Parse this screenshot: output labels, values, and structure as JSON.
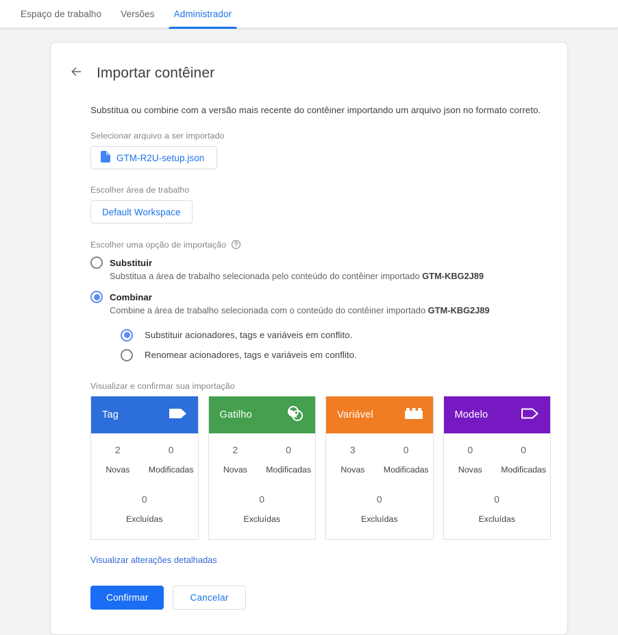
{
  "topbar": {
    "tabs": [
      {
        "label": "Espaço de trabalho",
        "active": false
      },
      {
        "label": "Versões",
        "active": false
      },
      {
        "label": "Administrador",
        "active": true
      }
    ]
  },
  "card": {
    "back_icon": "arrow-left-icon",
    "title": "Importar contêiner",
    "intro": "Substitua ou combine com a versão mais recente do contêiner importando um arquivo json no formato correto.",
    "file_section": {
      "label": "Selecionar arquivo a ser importado",
      "file_icon": "file-icon",
      "file_name": "GTM-R2U-setup.json"
    },
    "workspace_section": {
      "label": "Escolher área de trabalho",
      "workspace_name": "Default Workspace"
    },
    "import_option": {
      "label": "Escolher uma opção de importação",
      "help_icon": "help-circle-icon",
      "options": [
        {
          "label": "Substituir",
          "selected": false,
          "desc_prefix": "Substitua a área de trabalho selecionada pelo conteúdo do contêiner importado ",
          "container_id": "GTM-KBG2J89"
        },
        {
          "label": "Combinar",
          "selected": true,
          "desc_prefix": "Combine a área de trabalho selecionada com o conteúdo do contêiner importado ",
          "container_id": "GTM-KBG2J89"
        }
      ],
      "sub_options": [
        {
          "label": "Substituir acionadores, tags e variáveis em conflito.",
          "selected": true
        },
        {
          "label": "Renomear acionadores, tags e variáveis em conflito.",
          "selected": false
        }
      ]
    },
    "summary": {
      "label": "Visualizar e confirmar sua importação",
      "captions": {
        "new": "Novas",
        "modified": "Modificadas",
        "deleted": "Excluídas"
      },
      "cards": [
        {
          "title": "Tag",
          "icon": "tag-filled-icon",
          "color": "#2c6fdb",
          "new": "2",
          "modified": "0",
          "deleted": "0"
        },
        {
          "title": "Gatilho",
          "icon": "trigger-rings-icon",
          "color": "#44a04f",
          "new": "2",
          "modified": "0",
          "deleted": "0"
        },
        {
          "title": "Variável",
          "icon": "brick-icon",
          "color": "#f07d23",
          "new": "3",
          "modified": "0",
          "deleted": "0"
        },
        {
          "title": "Modelo",
          "icon": "tag-outline-icon",
          "color": "#7719c2",
          "new": "0",
          "modified": "0",
          "deleted": "0"
        }
      ]
    },
    "detail_link": "Visualizar alterações detalhadas",
    "actions": {
      "confirm": "Confirmar",
      "cancel": "Cancelar"
    }
  }
}
